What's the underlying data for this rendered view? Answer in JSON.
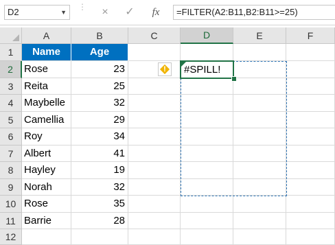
{
  "formula_bar": {
    "name_box": "D2",
    "cancel_icon": "×",
    "enter_icon": "✓",
    "fx_label": "fx",
    "formula": "=FILTER(A2:B11,B2:B11>=25)"
  },
  "columns": [
    "A",
    "B",
    "C",
    "D",
    "E",
    "F"
  ],
  "rows": [
    "1",
    "2",
    "3",
    "4",
    "5",
    "6",
    "7",
    "8",
    "9",
    "10",
    "11",
    "12"
  ],
  "sheet": {
    "headers": {
      "name": "Name",
      "age": "Age"
    },
    "data": [
      {
        "name": "Rose",
        "age": "23"
      },
      {
        "name": "Reita",
        "age": "25"
      },
      {
        "name": "Maybelle",
        "age": "32"
      },
      {
        "name": "Camellia",
        "age": "29"
      },
      {
        "name": "Roy",
        "age": "34"
      },
      {
        "name": "Albert",
        "age": "41"
      },
      {
        "name": "Hayley",
        "age": "19"
      },
      {
        "name": "Norah",
        "age": "32"
      },
      {
        "name": "Rose",
        "age": "35"
      },
      {
        "name": "Barrie",
        "age": "28"
      }
    ],
    "active_cell_value": "#SPILL!",
    "warning_icon": "!"
  },
  "colors": {
    "header_fill": "#0070c0",
    "spill_border": "#2e75b6",
    "selection": "#217346",
    "warning": "#f0b400"
  }
}
